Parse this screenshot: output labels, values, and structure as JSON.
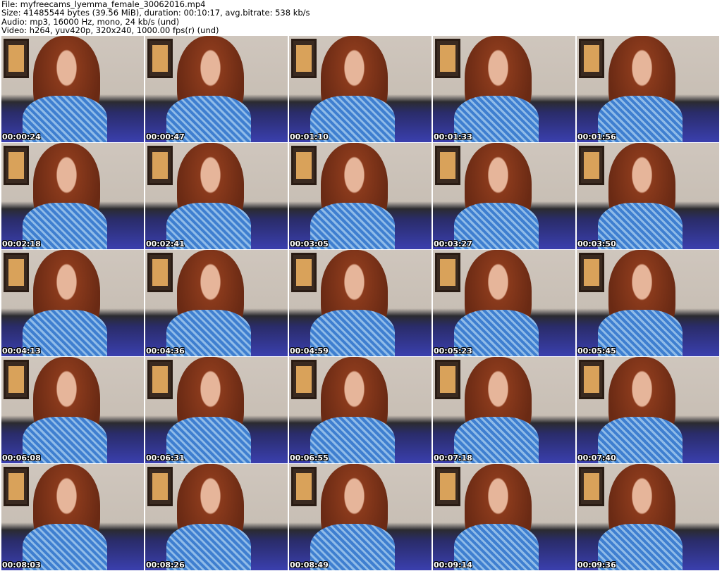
{
  "header": {
    "file": "File: myfreecams_lyemma_female_30062016.mp4",
    "size": "Size: 41485544 bytes (39.56 MiB), duration: 00:10:17, avg.bitrate: 538 kb/s",
    "audio": "Audio: mp3, 16000 Hz, mono, 24 kb/s (und)",
    "video": "Video: h264, yuv420p, 320x240, 1000.00 fps(r) (und)"
  },
  "thumbnails": [
    "00:00:24",
    "00:00:47",
    "00:01:10",
    "00:01:33",
    "00:01:56",
    "00:02:18",
    "00:02:41",
    "00:03:05",
    "00:03:27",
    "00:03:50",
    "00:04:13",
    "00:04:36",
    "00:04:59",
    "00:05:23",
    "00:05:45",
    "00:06:08",
    "00:06:31",
    "00:06:55",
    "00:07:18",
    "00:07:40",
    "00:08:03",
    "00:08:26",
    "00:08:49",
    "00:09:14",
    "00:09:36"
  ]
}
